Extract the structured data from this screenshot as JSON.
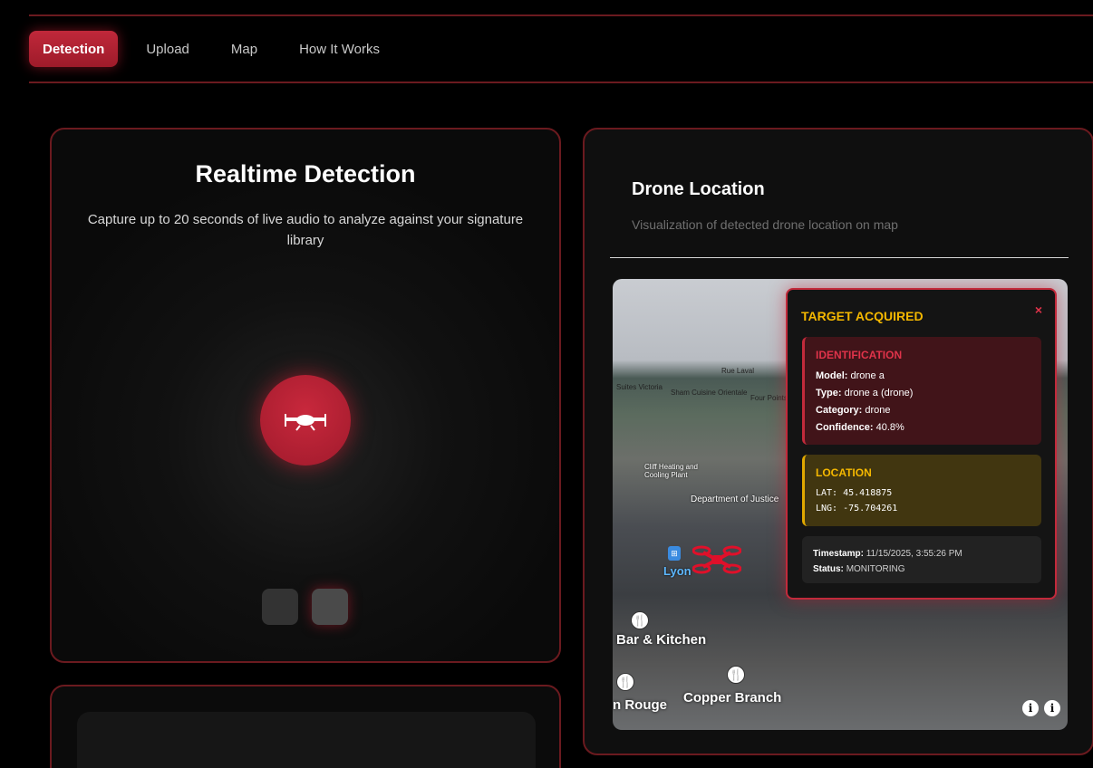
{
  "nav": {
    "tabs": [
      {
        "label": "Detection",
        "active": true
      },
      {
        "label": "Upload"
      },
      {
        "label": "Map"
      },
      {
        "label": "How It Works"
      }
    ]
  },
  "detection": {
    "title": "Realtime Detection",
    "description": "Capture up to 20 seconds of live audio to analyze against your signature library",
    "record_icon": "drone-icon"
  },
  "location": {
    "title": "Drone Location",
    "subtitle": "Visualization of detected drone location on map"
  },
  "map": {
    "labels": [
      "Rue Laval",
      "Sham Cuisine Orientale",
      "Four Points by Sheraton",
      "Cliff Heating and Cooling Plant",
      "Department of Justice",
      "Lyon",
      "Bar & Kitchen",
      "Copper Branch",
      "n Rouge",
      "Suites Victoria"
    ]
  },
  "popup": {
    "title": "TARGET ACQUIRED",
    "close": "×",
    "identification": {
      "heading": "IDENTIFICATION",
      "model_label": "Model:",
      "model": "drone a",
      "type_label": "Type:",
      "type": "drone a (drone)",
      "category_label": "Category:",
      "category": "drone",
      "confidence_label": "Confidence:",
      "confidence": "40.8%"
    },
    "location": {
      "heading": "LOCATION",
      "lat": "LAT: 45.418875",
      "lng": "LNG: -75.704261"
    },
    "status": {
      "timestamp_label": "Timestamp:",
      "timestamp": "11/15/2025, 3:55:26 PM",
      "status_label": "Status:",
      "status": "MONITORING"
    }
  },
  "colors": {
    "accent": "#c22a3b",
    "warning": "#f5b800"
  }
}
